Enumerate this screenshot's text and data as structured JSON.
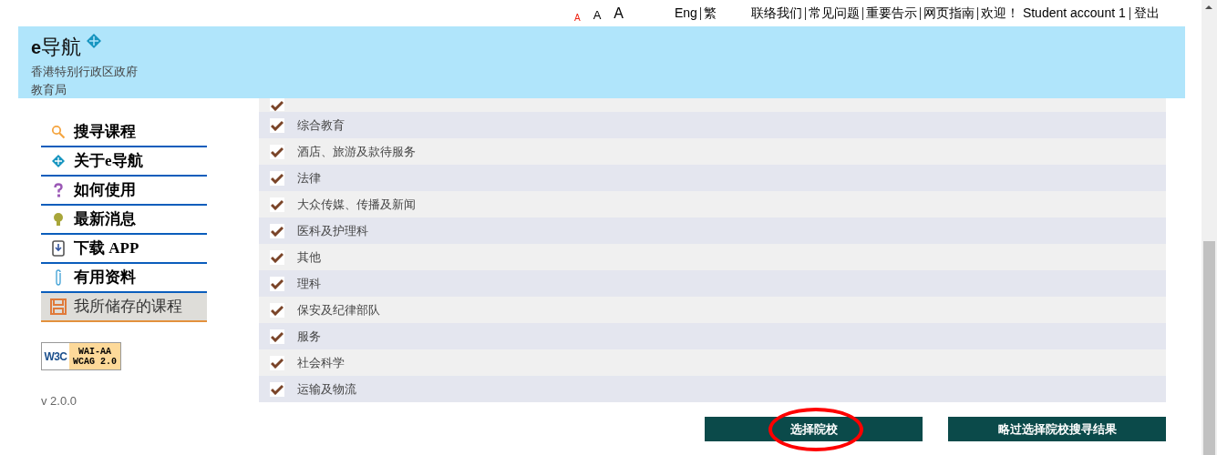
{
  "font_sizes": [
    "A",
    "A",
    "A"
  ],
  "language_links": [
    "Eng",
    "繁"
  ],
  "top_links": [
    "联络我们",
    "常见问题",
    "重要告示",
    "网页指南"
  ],
  "welcome": "欢迎！ Student account 1",
  "logout": "登出",
  "header": {
    "logo_prefix": "e",
    "logo_text": "导航",
    "subtitle_lines": [
      "香港特别行政区政府",
      "教育局"
    ]
  },
  "sidebar": {
    "items": [
      {
        "label": "搜寻课程",
        "selected": false
      },
      {
        "label": "关于e导航",
        "selected": false
      },
      {
        "label": "如何使用",
        "selected": false
      },
      {
        "label": "最新消息",
        "selected": false
      },
      {
        "label": "下载 APP",
        "selected": false
      },
      {
        "label": "有用资料",
        "selected": false
      },
      {
        "label": "我所储存的课程",
        "selected": true
      }
    ]
  },
  "badge": {
    "left": "W3C",
    "right_lines": [
      "WAI-AA",
      "WCAG 2.0"
    ]
  },
  "version": "v 2.0.0",
  "categories": [
    {
      "checked": true
    },
    {
      "label": "综合教育",
      "checked": true
    },
    {
      "label": "酒店、旅游及款待服务",
      "checked": true
    },
    {
      "label": "法律",
      "checked": true
    },
    {
      "label": "大众传媒、传播及新闻",
      "checked": true
    },
    {
      "label": "医科及护理科",
      "checked": true
    },
    {
      "label": "其他",
      "checked": true
    },
    {
      "label": "理科",
      "checked": true
    },
    {
      "label": "保安及纪律部队",
      "checked": true
    },
    {
      "label": "服务",
      "checked": true
    },
    {
      "label": "社会科学",
      "checked": true
    },
    {
      "label": "运输及物流",
      "checked": true
    }
  ],
  "buttons": [
    {
      "label": "选择院校",
      "highlighted": true
    },
    {
      "label": "略过选择院校搜寻结果",
      "highlighted": false
    }
  ]
}
